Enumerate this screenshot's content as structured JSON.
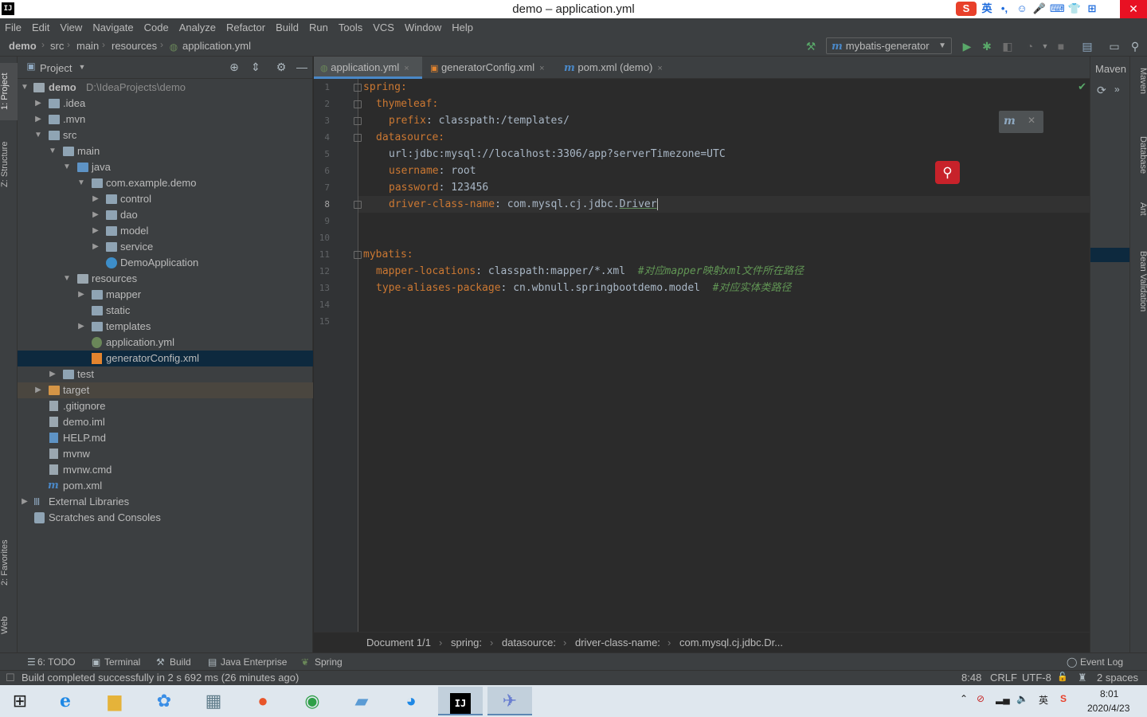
{
  "window": {
    "title": "demo – application.yml",
    "app_icon_label": "IJ",
    "close_label": "✕",
    "ime_items": [
      "S",
      "英",
      "•,",
      "☺",
      "🎤",
      "⌨",
      "👕",
      "⊞"
    ]
  },
  "menu": [
    "File",
    "Edit",
    "View",
    "Navigate",
    "Code",
    "Analyze",
    "Refactor",
    "Build",
    "Run",
    "Tools",
    "VCS",
    "Window",
    "Help"
  ],
  "breadcrumb": [
    "demo",
    "src",
    "main",
    "resources",
    "application.yml"
  ],
  "run_config": {
    "label": "mybatis-generator",
    "logo": "m"
  },
  "left_strip": {
    "project": "1: Project",
    "structure": "Z: Structure",
    "favorites": "2: Favorites",
    "web": "Web"
  },
  "project_panel": {
    "title": "Project",
    "tree": [
      {
        "label": "demo",
        "extra": "D:\\IdeaProjects\\demo"
      },
      {
        "label": ".idea"
      },
      {
        "label": ".mvn"
      },
      {
        "label": "src"
      },
      {
        "label": "main"
      },
      {
        "label": "java"
      },
      {
        "label": "com.example.demo"
      },
      {
        "label": "control"
      },
      {
        "label": "dao"
      },
      {
        "label": "model"
      },
      {
        "label": "service"
      },
      {
        "label": "DemoApplication"
      },
      {
        "label": "resources"
      },
      {
        "label": "mapper"
      },
      {
        "label": "static"
      },
      {
        "label": "templates"
      },
      {
        "label": "application.yml"
      },
      {
        "label": "generatorConfig.xml"
      },
      {
        "label": "test"
      },
      {
        "label": "target"
      },
      {
        "label": ".gitignore"
      },
      {
        "label": "demo.iml"
      },
      {
        "label": "HELP.md"
      },
      {
        "label": "mvnw"
      },
      {
        "label": "mvnw.cmd"
      },
      {
        "label": "pom.xml"
      },
      {
        "label": "External Libraries"
      },
      {
        "label": "Scratches and Consoles"
      }
    ]
  },
  "tabs": [
    {
      "label": "application.yml",
      "close": "×"
    },
    {
      "label": "generatorConfig.xml",
      "close": "×"
    },
    {
      "label": "pom.xml (demo)",
      "close": "×"
    }
  ],
  "editor": {
    "line_numbers": [
      "1",
      "2",
      "3",
      "4",
      "5",
      "6",
      "7",
      "8",
      "9",
      "10",
      "11",
      "12",
      "13",
      "14",
      "15"
    ],
    "current_line": 8,
    "lines": [
      {
        "key": "spring",
        "sep": ":",
        "val": "",
        "comment": ""
      },
      {
        "key": "thymeleaf",
        "sep": ":",
        "val": "",
        "comment": ""
      },
      {
        "key": "prefix",
        "sep": ":",
        "val": " classpath:/templates/",
        "comment": ""
      },
      {
        "key": "datasource",
        "sep": ":",
        "val": "",
        "comment": ""
      },
      {
        "key": "url",
        "sep": ":",
        "val": "jdbc:mysql://localhost:3306/app?serverTimezone=UTC",
        "comment": ""
      },
      {
        "key": "username",
        "sep": ":",
        "val": " root",
        "comment": ""
      },
      {
        "key": "password",
        "sep": ":",
        "val": " 123456",
        "comment": ""
      },
      {
        "key": "driver-class-name",
        "sep": ":",
        "val": " com.mysql.cj.jdbc.",
        "val2": "Driver",
        "comment": ""
      },
      {
        "key": "",
        "sep": "",
        "val": "",
        "comment": ""
      },
      {
        "key": "",
        "sep": "",
        "val": "",
        "comment": ""
      },
      {
        "key": "mybatis",
        "sep": ":",
        "val": "",
        "comment": ""
      },
      {
        "key": "mapper-locations",
        "sep": ":",
        "val": " classpath:mapper/*.xml",
        "comment": "#对应mapper映射xml文件所在路径"
      },
      {
        "key": "type-aliases-package",
        "sep": ":",
        "val": " cn.wbnull.springbootdemo.model",
        "comment": "#对应实体类路径"
      },
      {
        "key": "",
        "sep": "",
        "val": "",
        "comment": ""
      },
      {
        "key": "",
        "sep": "",
        "val": "",
        "comment": ""
      }
    ]
  },
  "editor_breadcrumb": [
    "Document 1/1",
    "spring:",
    "datasource:",
    "driver-class-name:",
    "com.mysql.cj.jdbc.Dr..."
  ],
  "maven": {
    "title": "Maven"
  },
  "right_strip": [
    "Maven",
    "Database",
    "Ant",
    "Bean Validation"
  ],
  "bottom_tools": [
    "6: TODO",
    "Terminal",
    "Build",
    "Java Enterprise",
    "Spring",
    "Event Log"
  ],
  "status": {
    "message": "Build completed successfully in 2 s 692 ms (26 minutes ago)",
    "position": "8:48",
    "line_sep": "CRLF",
    "encoding": "UTF-8",
    "indent": "2 spaces"
  },
  "taskbar": {
    "time": "8:01",
    "date": "2020/4/23",
    "ime": "英"
  },
  "colors": {
    "bg": "#2b2b2b",
    "panel": "#3c3f41",
    "key": "#cc7832",
    "comment": "#629755",
    "selection": "#0d293e"
  }
}
